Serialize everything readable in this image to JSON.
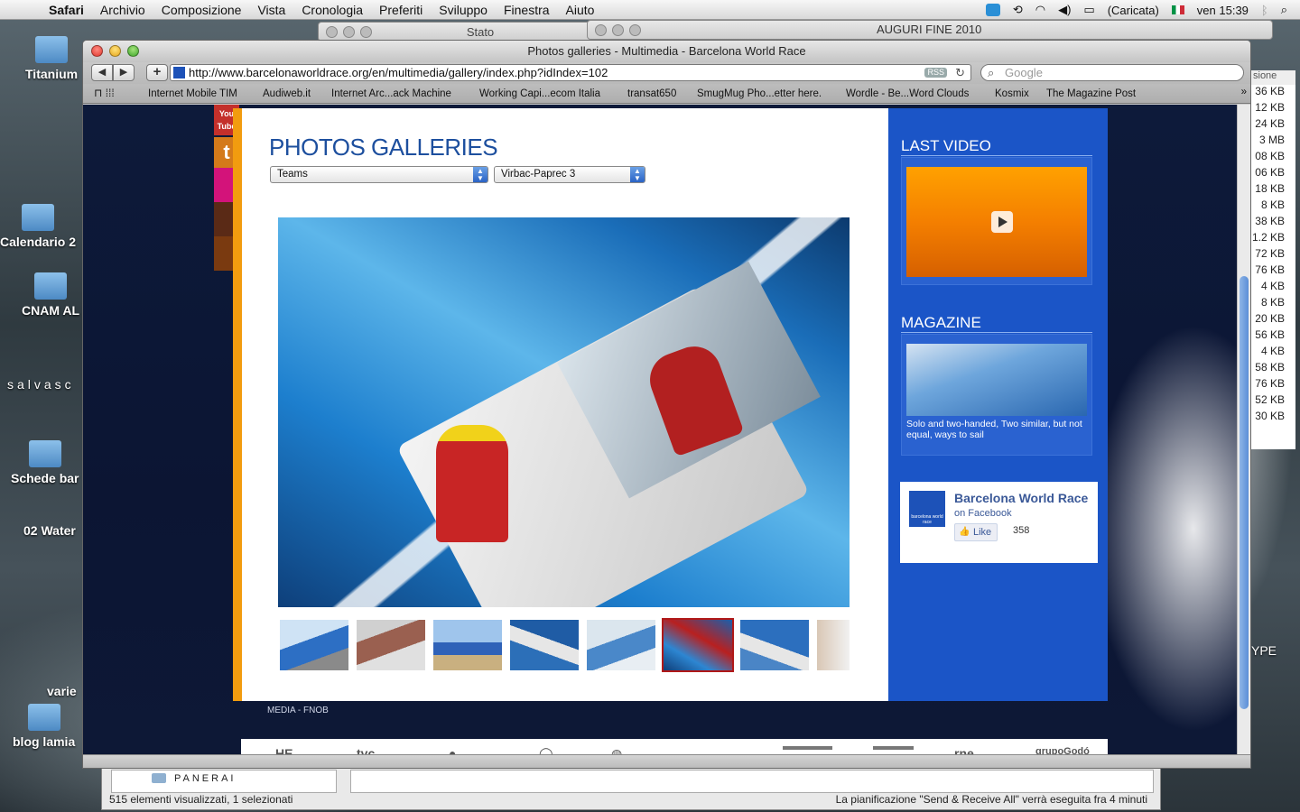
{
  "menubar": {
    "apple": "",
    "app_name": "Safari",
    "menus": [
      "Archivio",
      "Composizione",
      "Vista",
      "Cronologia",
      "Preferiti",
      "Sviluppo",
      "Finestra",
      "Aiuto"
    ],
    "battery": "(Caricata)",
    "clock": "ven 15:39"
  },
  "background_windows": {
    "stato_title": "Stato",
    "auguri_title": "AUGURI FINE 2010",
    "size_column_header": "sione",
    "sizes": [
      "36 KB",
      "12 KB",
      "24 KB",
      "3 MB",
      "08 KB",
      "06 KB",
      "18 KB",
      "8 KB",
      "38 KB",
      "1.2 KB",
      "72 KB",
      "76 KB",
      "4 KB",
      "8 KB",
      "20 KB",
      "56 KB",
      "4 KB",
      "58 KB",
      "76 KB",
      "52 KB",
      "30 KB"
    ],
    "finder_status_left": "515 elementi visualizzati, 1 selezionati",
    "finder_folder": "PANERAI",
    "mail_status_right": "La pianificazione \"Send & Receive All\" verrà eseguita fra 4 minuti",
    "right_partial_text": "YPE"
  },
  "desktop_icons": [
    "Titanium",
    "Calendario 2",
    "CNAM AL",
    "salvasc",
    "Schede bar",
    "02 Water",
    "varie",
    "blog lamia"
  ],
  "safari": {
    "window_title": "Photos galleries - Multimedia - Barcelona World Race",
    "url": "http://www.barcelonaworldrace.org/en/multimedia/gallery/index.php?idIndex=102",
    "rss": "RSS",
    "search_placeholder": "Google",
    "bookmarks": [
      "Internet Mobile TIM",
      "Audiweb.it",
      "Internet Arc...ack Machine",
      "Working Capi...ecom Italia",
      "transat650",
      "SmugMug Pho...etter here.",
      "Wordle - Be...Word Clouds",
      "Kosmix",
      "The Magazine Post"
    ]
  },
  "page": {
    "social": {
      "youtube": "You Tube",
      "twitter": "t"
    },
    "title": "PHOTOS GALLERIES",
    "category_select": "Teams",
    "team_select": "Virbac-Paprec 3",
    "thumbnails_count": 8,
    "active_thumbnail_index": 5,
    "sidebar": {
      "last_video_title": "LAST VIDEO",
      "magazine_title": "MAGAZINE",
      "magazine_caption": "Solo and two-handed, Two similar, but not equal, ways to sail"
    },
    "facebook": {
      "name": "Barcelona World Race",
      "on": "on Facebook",
      "like_label": "Like",
      "like_count": "358",
      "logo_text": "barcelona world race"
    },
    "footer_links": "MEDIA  -  FNOB"
  },
  "colors": {
    "brand_blue": "#1b55c7",
    "title_blue": "#1d4f9e",
    "accent_orange": "#f29c0f",
    "page_bg": "#0d1836"
  }
}
